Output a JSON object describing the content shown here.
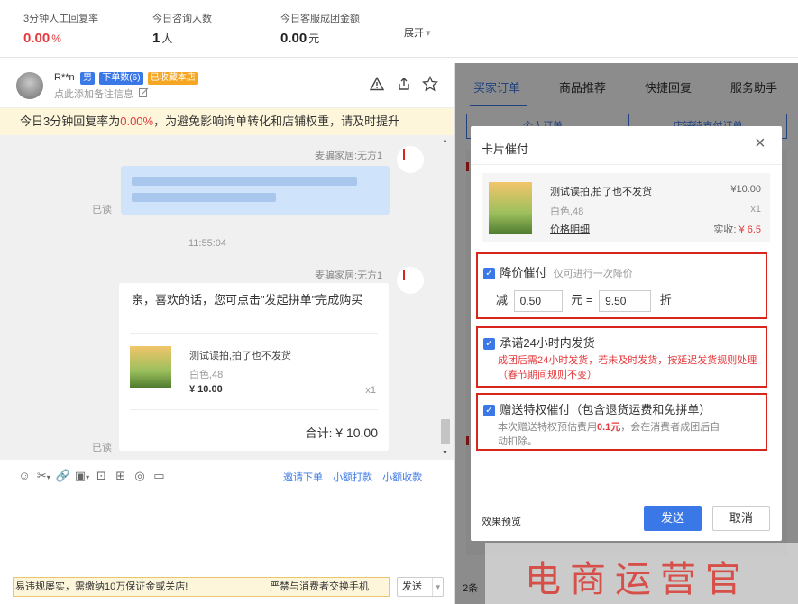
{
  "stats": [
    {
      "label": "3分钟人工回复率",
      "value": "0.00",
      "unit": "%"
    },
    {
      "label": "今日咨询人数",
      "value": "1",
      "unit": "人"
    },
    {
      "label": "今日客服成团金额",
      "value": "0.00",
      "unit": "元"
    }
  ],
  "expand_label": "展开",
  "expand_caret": "▾",
  "customer": {
    "name": "R**n",
    "gender_badge": "男",
    "orders_badge": "下单数(6)",
    "fav_badge": "已收藏本店",
    "note_hint": "点此添加备注信息",
    "colors": {
      "male": "#3b78e7",
      "orders": "#3b78e7",
      "fav": "#f5a623"
    }
  },
  "warning": {
    "prefix": "今日3分钟回复率为",
    "rate": "0.00%",
    "suffix": "，为避免影响询单转化和店铺权重，请及时提升"
  },
  "chat": {
    "sender1": "麦骗家居:无方1",
    "read1": "已读",
    "time": "11:55:04",
    "sender2": "麦骗家居:无方1",
    "msg_text": "亲，喜欢的话，您可点击\"发起拼单\"完成购买",
    "product_title": "测试误拍,拍了也不发货",
    "product_spec": "白色,48",
    "product_price": "¥ 10.00",
    "product_qty": "x1",
    "total_label": "合计:",
    "total_value": "¥ 10.00",
    "read2": "已读"
  },
  "toolbar": {
    "icons": [
      "smile-icon",
      "scissors-icon",
      "link-icon",
      "image-icon",
      "video-icon",
      "coupon-icon",
      "search-icon",
      "folder-icon"
    ],
    "invite_order": "邀请下单",
    "small_pay": "小额打款",
    "small_collect": "小额收款"
  },
  "input_bar": {
    "hint1": "易违规屡实，需缴纳10万保证金或关店!",
    "hint2": "严禁与消费者交换手机",
    "send": "发送",
    "caret": "▾"
  },
  "right_tabs": [
    "买家订单",
    "商品推荐",
    "快捷回复",
    "服务助手"
  ],
  "sub_tabs": [
    "个人订单",
    "店铺待支付订单"
  ],
  "footer_count": "2条",
  "modal": {
    "title": "卡片催付",
    "close": "×",
    "product_title": "测试误拍,拍了也不发货",
    "product_price": "¥10.00",
    "product_spec": "白色,48",
    "product_qty": "x1",
    "price_detail": "价格明细",
    "paid_label": "实收:",
    "paid_value": "¥ 6.5",
    "opt1_title": "降价催付",
    "opt1_hint": "仅可进行一次降价",
    "opt1_minus": "减",
    "opt1_amount": "0.50",
    "opt1_unit": "元 =",
    "opt1_discount": "9.50",
    "opt1_discount_unit": "折",
    "opt2_title": "承诺24小时内发货",
    "opt2_desc": "成团后需24小时发货，若未及时发货，按延迟发货规则处理（春节期间规则不变）",
    "opt3_title": "赠送特权催付（包含退货运费和免拼单）",
    "opt3_desc_prefix": "本次赠送特权预估费用",
    "opt3_fee": "0.1元",
    "opt3_desc_suffix": "，会在消费者成团后自动扣除。",
    "preview": "效果预览",
    "send": "发送",
    "cancel": "取消"
  },
  "watermark": "电商运营官"
}
